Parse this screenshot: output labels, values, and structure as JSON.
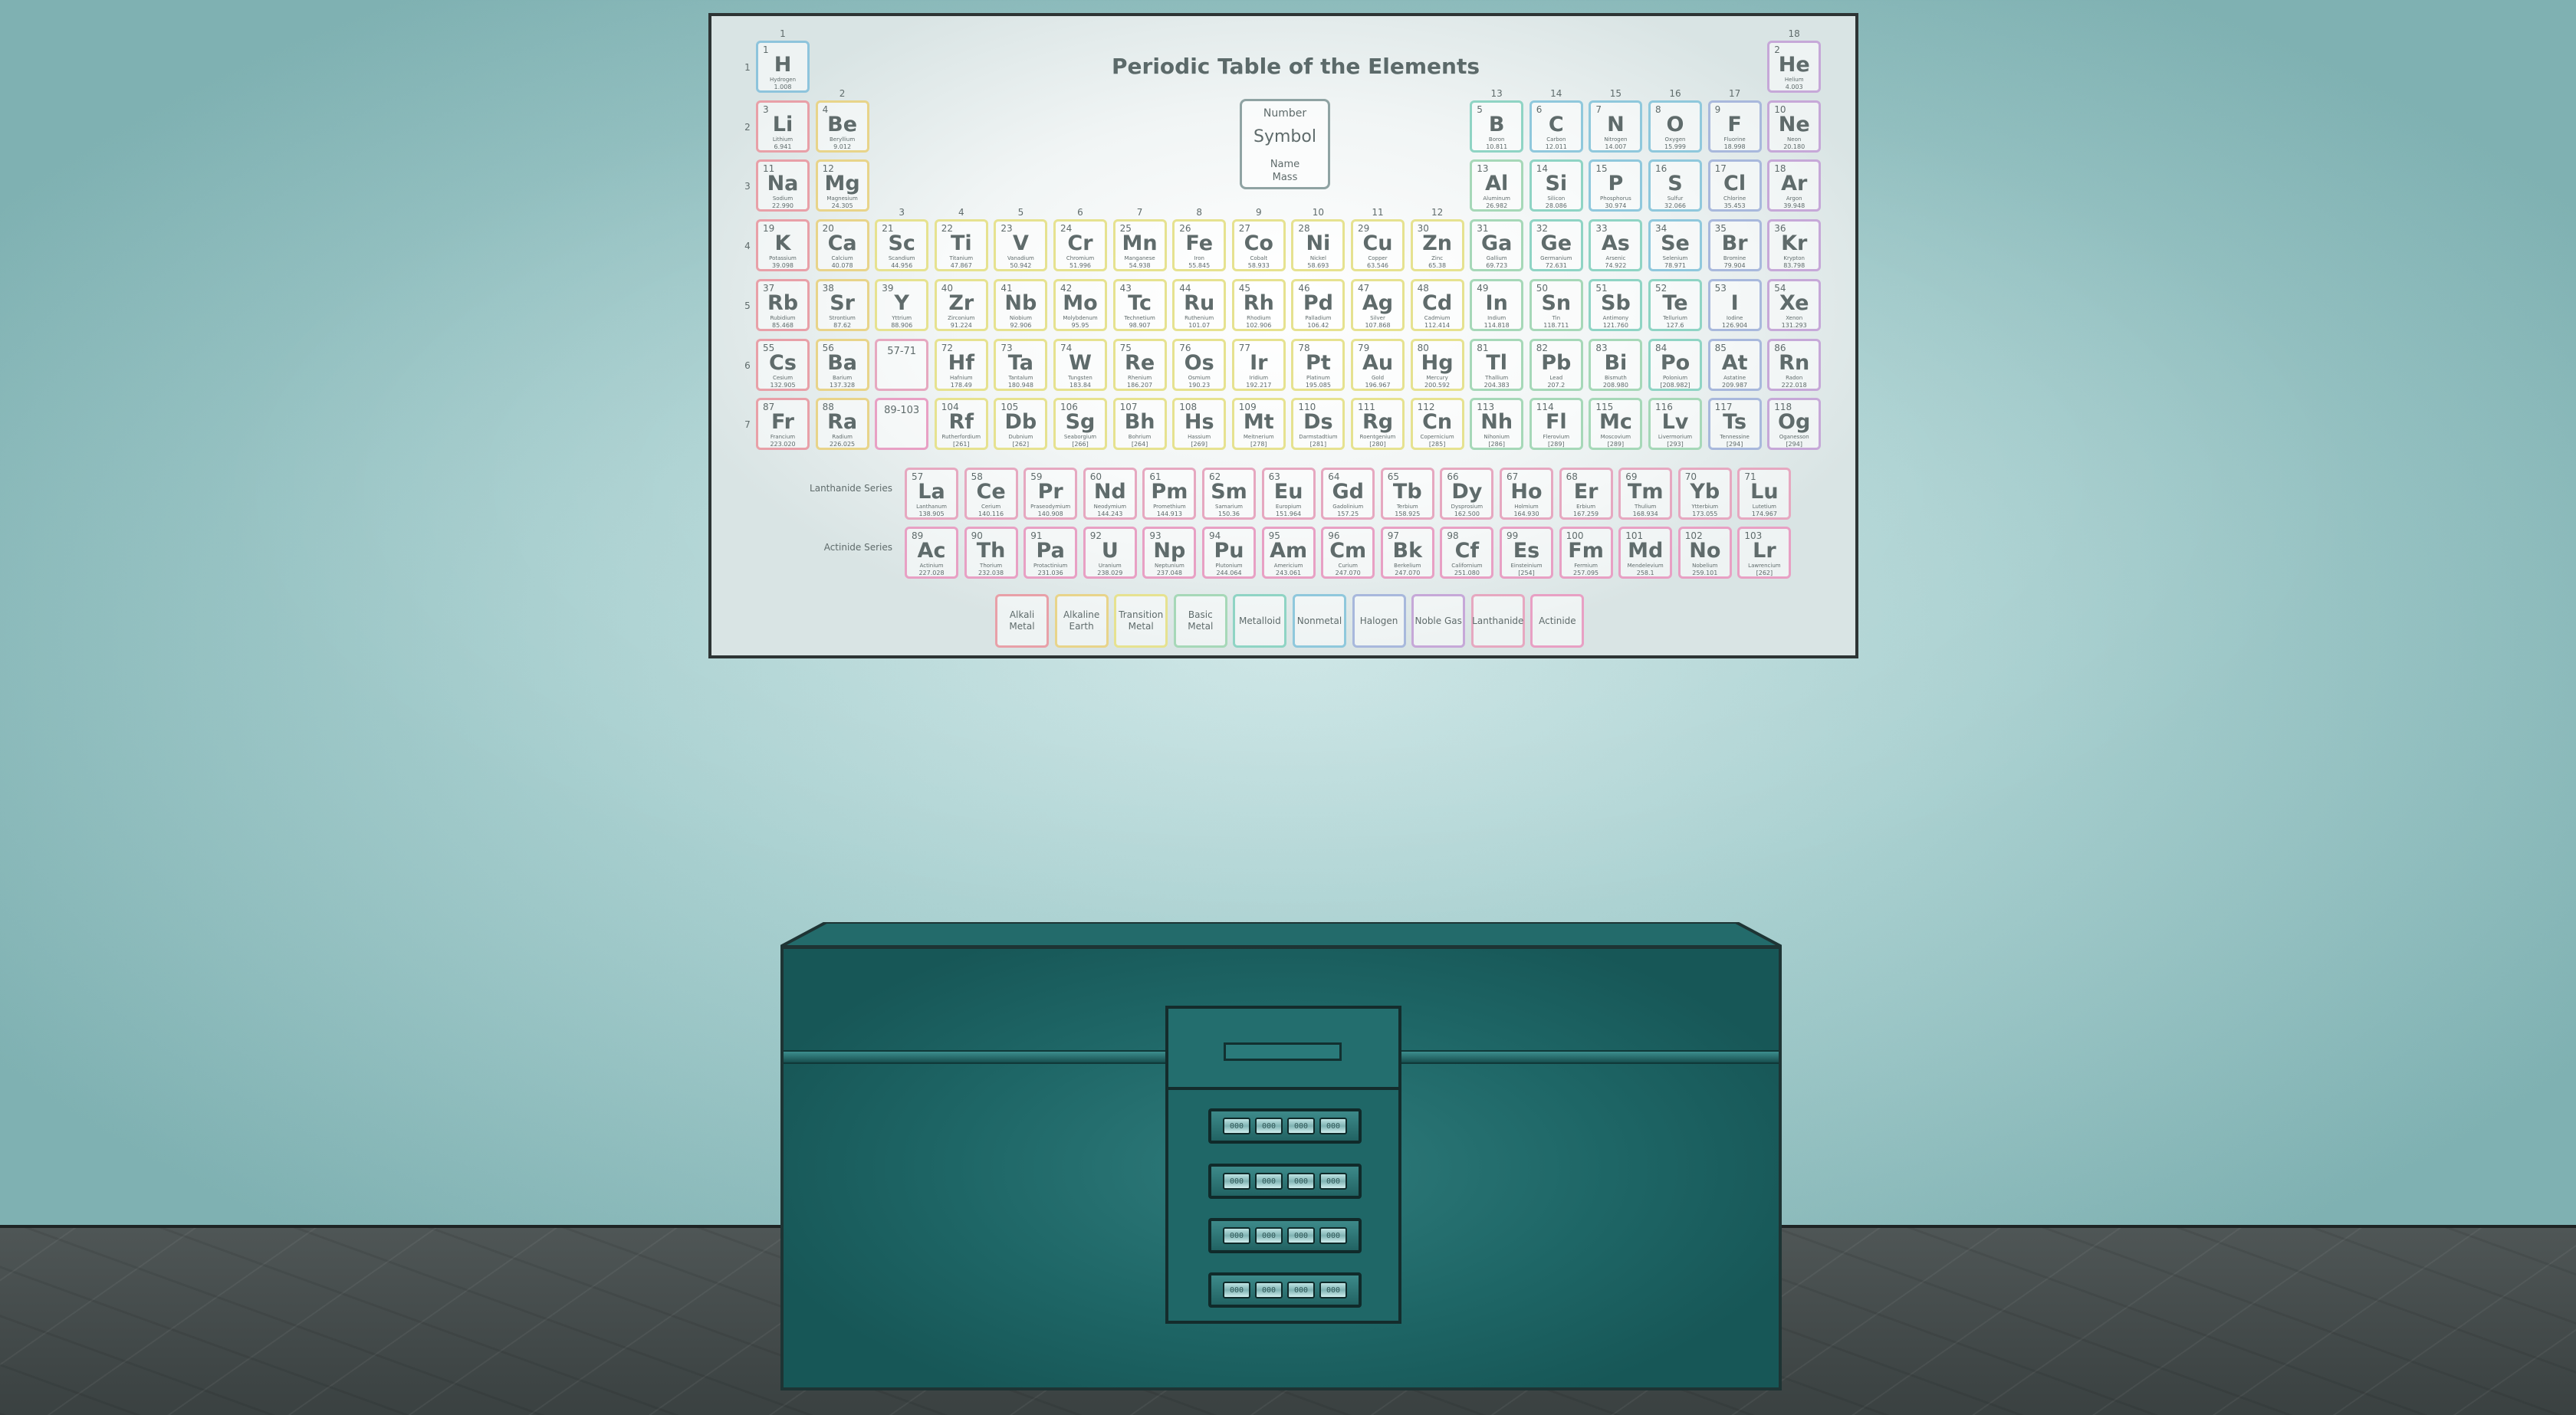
{
  "poster": {
    "title": "Periodic Table of the Elements",
    "key": {
      "number": "Number",
      "symbol": "Symbol",
      "name": "Name",
      "mass": "Mass"
    },
    "lanthanide_label": "Lanthanide Series",
    "actinide_label": "Actinide Series",
    "groups": [
      "1",
      "2",
      "3",
      "4",
      "5",
      "6",
      "7",
      "8",
      "9",
      "10",
      "11",
      "12",
      "13",
      "14",
      "15",
      "16",
      "17",
      "18"
    ],
    "periods": [
      "1",
      "2",
      "3",
      "4",
      "5",
      "6",
      "7"
    ],
    "category_colors": {
      "alkali": "#e8a0a8",
      "alkaline": "#e8d48a",
      "transition": "#e6e290",
      "basic": "#a6d8b8",
      "metalloid": "#8fd4c4",
      "nonmetal": "#8fc8dc",
      "halogen": "#a8b8dc",
      "noble": "#c6a8d8",
      "lanthanide": "#e6a8c0",
      "actinide": "#e8a0c4",
      "hydrogen": "#8ec4dc"
    },
    "legend": [
      {
        "label": "Alkali Metal",
        "cat": "alkali"
      },
      {
        "label": "Alkaline Earth",
        "cat": "alkaline"
      },
      {
        "label": "Transition Metal",
        "cat": "transition"
      },
      {
        "label": "Basic Metal",
        "cat": "basic"
      },
      {
        "label": "Metalloid",
        "cat": "metalloid"
      },
      {
        "label": "Nonmetal",
        "cat": "nonmetal"
      },
      {
        "label": "Halogen",
        "cat": "halogen"
      },
      {
        "label": "Noble Gas",
        "cat": "noble"
      },
      {
        "label": "Lanthanide",
        "cat": "lanthanide"
      },
      {
        "label": "Actinide",
        "cat": "actinide"
      }
    ],
    "elements": [
      {
        "n": 1,
        "s": "H",
        "name": "Hydrogen",
        "m": "1.008",
        "g": 1,
        "p": 1,
        "c": "hydrogen"
      },
      {
        "n": 2,
        "s": "He",
        "name": "Helium",
        "m": "4.003",
        "g": 18,
        "p": 1,
        "c": "noble"
      },
      {
        "n": 3,
        "s": "Li",
        "name": "Lithium",
        "m": "6.941",
        "g": 1,
        "p": 2,
        "c": "alkali"
      },
      {
        "n": 4,
        "s": "Be",
        "name": "Beryllium",
        "m": "9.012",
        "g": 2,
        "p": 2,
        "c": "alkaline"
      },
      {
        "n": 5,
        "s": "B",
        "name": "Boron",
        "m": "10.811",
        "g": 13,
        "p": 2,
        "c": "metalloid"
      },
      {
        "n": 6,
        "s": "C",
        "name": "Carbon",
        "m": "12.011",
        "g": 14,
        "p": 2,
        "c": "nonmetal"
      },
      {
        "n": 7,
        "s": "N",
        "name": "Nitrogen",
        "m": "14.007",
        "g": 15,
        "p": 2,
        "c": "nonmetal"
      },
      {
        "n": 8,
        "s": "O",
        "name": "Oxygen",
        "m": "15.999",
        "g": 16,
        "p": 2,
        "c": "nonmetal"
      },
      {
        "n": 9,
        "s": "F",
        "name": "Fluorine",
        "m": "18.998",
        "g": 17,
        "p": 2,
        "c": "halogen"
      },
      {
        "n": 10,
        "s": "Ne",
        "name": "Neon",
        "m": "20.180",
        "g": 18,
        "p": 2,
        "c": "noble"
      },
      {
        "n": 11,
        "s": "Na",
        "name": "Sodium",
        "m": "22.990",
        "g": 1,
        "p": 3,
        "c": "alkali"
      },
      {
        "n": 12,
        "s": "Mg",
        "name": "Magnesium",
        "m": "24.305",
        "g": 2,
        "p": 3,
        "c": "alkaline"
      },
      {
        "n": 13,
        "s": "Al",
        "name": "Aluminum",
        "m": "26.982",
        "g": 13,
        "p": 3,
        "c": "basic"
      },
      {
        "n": 14,
        "s": "Si",
        "name": "Silicon",
        "m": "28.086",
        "g": 14,
        "p": 3,
        "c": "metalloid"
      },
      {
        "n": 15,
        "s": "P",
        "name": "Phosphorus",
        "m": "30.974",
        "g": 15,
        "p": 3,
        "c": "nonmetal"
      },
      {
        "n": 16,
        "s": "S",
        "name": "Sulfur",
        "m": "32.066",
        "g": 16,
        "p": 3,
        "c": "nonmetal"
      },
      {
        "n": 17,
        "s": "Cl",
        "name": "Chlorine",
        "m": "35.453",
        "g": 17,
        "p": 3,
        "c": "halogen"
      },
      {
        "n": 18,
        "s": "Ar",
        "name": "Argon",
        "m": "39.948",
        "g": 18,
        "p": 3,
        "c": "noble"
      },
      {
        "n": 19,
        "s": "K",
        "name": "Potassium",
        "m": "39.098",
        "g": 1,
        "p": 4,
        "c": "alkali"
      },
      {
        "n": 20,
        "s": "Ca",
        "name": "Calcium",
        "m": "40.078",
        "g": 2,
        "p": 4,
        "c": "alkaline"
      },
      {
        "n": 21,
        "s": "Sc",
        "name": "Scandium",
        "m": "44.956",
        "g": 3,
        "p": 4,
        "c": "transition"
      },
      {
        "n": 22,
        "s": "Ti",
        "name": "Titanium",
        "m": "47.867",
        "g": 4,
        "p": 4,
        "c": "transition"
      },
      {
        "n": 23,
        "s": "V",
        "name": "Vanadium",
        "m": "50.942",
        "g": 5,
        "p": 4,
        "c": "transition"
      },
      {
        "n": 24,
        "s": "Cr",
        "name": "Chromium",
        "m": "51.996",
        "g": 6,
        "p": 4,
        "c": "transition"
      },
      {
        "n": 25,
        "s": "Mn",
        "name": "Manganese",
        "m": "54.938",
        "g": 7,
        "p": 4,
        "c": "transition"
      },
      {
        "n": 26,
        "s": "Fe",
        "name": "Iron",
        "m": "55.845",
        "g": 8,
        "p": 4,
        "c": "transition"
      },
      {
        "n": 27,
        "s": "Co",
        "name": "Cobalt",
        "m": "58.933",
        "g": 9,
        "p": 4,
        "c": "transition"
      },
      {
        "n": 28,
        "s": "Ni",
        "name": "Nickel",
        "m": "58.693",
        "g": 10,
        "p": 4,
        "c": "transition"
      },
      {
        "n": 29,
        "s": "Cu",
        "name": "Copper",
        "m": "63.546",
        "g": 11,
        "p": 4,
        "c": "transition"
      },
      {
        "n": 30,
        "s": "Zn",
        "name": "Zinc",
        "m": "65.38",
        "g": 12,
        "p": 4,
        "c": "transition"
      },
      {
        "n": 31,
        "s": "Ga",
        "name": "Gallium",
        "m": "69.723",
        "g": 13,
        "p": 4,
        "c": "basic"
      },
      {
        "n": 32,
        "s": "Ge",
        "name": "Germanium",
        "m": "72.631",
        "g": 14,
        "p": 4,
        "c": "metalloid"
      },
      {
        "n": 33,
        "s": "As",
        "name": "Arsenic",
        "m": "74.922",
        "g": 15,
        "p": 4,
        "c": "metalloid"
      },
      {
        "n": 34,
        "s": "Se",
        "name": "Selenium",
        "m": "78.971",
        "g": 16,
        "p": 4,
        "c": "nonmetal"
      },
      {
        "n": 35,
        "s": "Br",
        "name": "Bromine",
        "m": "79.904",
        "g": 17,
        "p": 4,
        "c": "halogen"
      },
      {
        "n": 36,
        "s": "Kr",
        "name": "Krypton",
        "m": "83.798",
        "g": 18,
        "p": 4,
        "c": "noble"
      },
      {
        "n": 37,
        "s": "Rb",
        "name": "Rubidium",
        "m": "85.468",
        "g": 1,
        "p": 5,
        "c": "alkali"
      },
      {
        "n": 38,
        "s": "Sr",
        "name": "Strontium",
        "m": "87.62",
        "g": 2,
        "p": 5,
        "c": "alkaline"
      },
      {
        "n": 39,
        "s": "Y",
        "name": "Yttrium",
        "m": "88.906",
        "g": 3,
        "p": 5,
        "c": "transition"
      },
      {
        "n": 40,
        "s": "Zr",
        "name": "Zirconium",
        "m": "91.224",
        "g": 4,
        "p": 5,
        "c": "transition"
      },
      {
        "n": 41,
        "s": "Nb",
        "name": "Niobium",
        "m": "92.906",
        "g": 5,
        "p": 5,
        "c": "transition"
      },
      {
        "n": 42,
        "s": "Mo",
        "name": "Molybdenum",
        "m": "95.95",
        "g": 6,
        "p": 5,
        "c": "transition"
      },
      {
        "n": 43,
        "s": "Tc",
        "name": "Technetium",
        "m": "98.907",
        "g": 7,
        "p": 5,
        "c": "transition"
      },
      {
        "n": 44,
        "s": "Ru",
        "name": "Ruthenium",
        "m": "101.07",
        "g": 8,
        "p": 5,
        "c": "transition"
      },
      {
        "n": 45,
        "s": "Rh",
        "name": "Rhodium",
        "m": "102.906",
        "g": 9,
        "p": 5,
        "c": "transition"
      },
      {
        "n": 46,
        "s": "Pd",
        "name": "Palladium",
        "m": "106.42",
        "g": 10,
        "p": 5,
        "c": "transition"
      },
      {
        "n": 47,
        "s": "Ag",
        "name": "Silver",
        "m": "107.868",
        "g": 11,
        "p": 5,
        "c": "transition"
      },
      {
        "n": 48,
        "s": "Cd",
        "name": "Cadmium",
        "m": "112.414",
        "g": 12,
        "p": 5,
        "c": "transition"
      },
      {
        "n": 49,
        "s": "In",
        "name": "Indium",
        "m": "114.818",
        "g": 13,
        "p": 5,
        "c": "basic"
      },
      {
        "n": 50,
        "s": "Sn",
        "name": "Tin",
        "m": "118.711",
        "g": 14,
        "p": 5,
        "c": "basic"
      },
      {
        "n": 51,
        "s": "Sb",
        "name": "Antimony",
        "m": "121.760",
        "g": 15,
        "p": 5,
        "c": "metalloid"
      },
      {
        "n": 52,
        "s": "Te",
        "name": "Tellurium",
        "m": "127.6",
        "g": 16,
        "p": 5,
        "c": "metalloid"
      },
      {
        "n": 53,
        "s": "I",
        "name": "Iodine",
        "m": "126.904",
        "g": 17,
        "p": 5,
        "c": "halogen"
      },
      {
        "n": 54,
        "s": "Xe",
        "name": "Xenon",
        "m": "131.293",
        "g": 18,
        "p": 5,
        "c": "noble"
      },
      {
        "n": 55,
        "s": "Cs",
        "name": "Cesium",
        "m": "132.905",
        "g": 1,
        "p": 6,
        "c": "alkali"
      },
      {
        "n": 56,
        "s": "Ba",
        "name": "Barium",
        "m": "137.328",
        "g": 2,
        "p": 6,
        "c": "alkaline"
      },
      {
        "n": 72,
        "s": "Hf",
        "name": "Hafnium",
        "m": "178.49",
        "g": 4,
        "p": 6,
        "c": "transition"
      },
      {
        "n": 73,
        "s": "Ta",
        "name": "Tantalum",
        "m": "180.948",
        "g": 5,
        "p": 6,
        "c": "transition"
      },
      {
        "n": 74,
        "s": "W",
        "name": "Tungsten",
        "m": "183.84",
        "g": 6,
        "p": 6,
        "c": "transition"
      },
      {
        "n": 75,
        "s": "Re",
        "name": "Rhenium",
        "m": "186.207",
        "g": 7,
        "p": 6,
        "c": "transition"
      },
      {
        "n": 76,
        "s": "Os",
        "name": "Osmium",
        "m": "190.23",
        "g": 8,
        "p": 6,
        "c": "transition"
      },
      {
        "n": 77,
        "s": "Ir",
        "name": "Iridium",
        "m": "192.217",
        "g": 9,
        "p": 6,
        "c": "transition"
      },
      {
        "n": 78,
        "s": "Pt",
        "name": "Platinum",
        "m": "195.085",
        "g": 10,
        "p": 6,
        "c": "transition"
      },
      {
        "n": 79,
        "s": "Au",
        "name": "Gold",
        "m": "196.967",
        "g": 11,
        "p": 6,
        "c": "transition"
      },
      {
        "n": 80,
        "s": "Hg",
        "name": "Mercury",
        "m": "200.592",
        "g": 12,
        "p": 6,
        "c": "transition"
      },
      {
        "n": 81,
        "s": "Tl",
        "name": "Thallium",
        "m": "204.383",
        "g": 13,
        "p": 6,
        "c": "basic"
      },
      {
        "n": 82,
        "s": "Pb",
        "name": "Lead",
        "m": "207.2",
        "g": 14,
        "p": 6,
        "c": "basic"
      },
      {
        "n": 83,
        "s": "Bi",
        "name": "Bismuth",
        "m": "208.980",
        "g": 15,
        "p": 6,
        "c": "basic"
      },
      {
        "n": 84,
        "s": "Po",
        "name": "Polonium",
        "m": "[208.982]",
        "g": 16,
        "p": 6,
        "c": "metalloid"
      },
      {
        "n": 85,
        "s": "At",
        "name": "Astatine",
        "m": "209.987",
        "g": 17,
        "p": 6,
        "c": "halogen"
      },
      {
        "n": 86,
        "s": "Rn",
        "name": "Radon",
        "m": "222.018",
        "g": 18,
        "p": 6,
        "c": "noble"
      },
      {
        "n": 87,
        "s": "Fr",
        "name": "Francium",
        "m": "223.020",
        "g": 1,
        "p": 7,
        "c": "alkali"
      },
      {
        "n": 88,
        "s": "Ra",
        "name": "Radium",
        "m": "226.025",
        "g": 2,
        "p": 7,
        "c": "alkaline"
      },
      {
        "n": 104,
        "s": "Rf",
        "name": "Rutherfordium",
        "m": "[261]",
        "g": 4,
        "p": 7,
        "c": "transition"
      },
      {
        "n": 105,
        "s": "Db",
        "name": "Dubnium",
        "m": "[262]",
        "g": 5,
        "p": 7,
        "c": "transition"
      },
      {
        "n": 106,
        "s": "Sg",
        "name": "Seaborgium",
        "m": "[266]",
        "g": 6,
        "p": 7,
        "c": "transition"
      },
      {
        "n": 107,
        "s": "Bh",
        "name": "Bohrium",
        "m": "[264]",
        "g": 7,
        "p": 7,
        "c": "transition"
      },
      {
        "n": 108,
        "s": "Hs",
        "name": "Hassium",
        "m": "[269]",
        "g": 8,
        "p": 7,
        "c": "transition"
      },
      {
        "n": 109,
        "s": "Mt",
        "name": "Meitnerium",
        "m": "[278]",
        "g": 9,
        "p": 7,
        "c": "transition"
      },
      {
        "n": 110,
        "s": "Ds",
        "name": "Darmstadtium",
        "m": "[281]",
        "g": 10,
        "p": 7,
        "c": "transition"
      },
      {
        "n": 111,
        "s": "Rg",
        "name": "Roentgenium",
        "m": "[280]",
        "g": 11,
        "p": 7,
        "c": "transition"
      },
      {
        "n": 112,
        "s": "Cn",
        "name": "Copernicium",
        "m": "[285]",
        "g": 12,
        "p": 7,
        "c": "transition"
      },
      {
        "n": 113,
        "s": "Nh",
        "name": "Nihonium",
        "m": "[286]",
        "g": 13,
        "p": 7,
        "c": "basic"
      },
      {
        "n": 114,
        "s": "Fl",
        "name": "Flerovium",
        "m": "[289]",
        "g": 14,
        "p": 7,
        "c": "basic"
      },
      {
        "n": 115,
        "s": "Mc",
        "name": "Moscovium",
        "m": "[289]",
        "g": 15,
        "p": 7,
        "c": "basic"
      },
      {
        "n": 116,
        "s": "Lv",
        "name": "Livermorium",
        "m": "[293]",
        "g": 16,
        "p": 7,
        "c": "basic"
      },
      {
        "n": 117,
        "s": "Ts",
        "name": "Tennessine",
        "m": "[294]",
        "g": 17,
        "p": 7,
        "c": "halogen"
      },
      {
        "n": 118,
        "s": "Og",
        "name": "Oganesson",
        "m": "[294]",
        "g": 18,
        "p": 7,
        "c": "noble"
      }
    ],
    "placeholders": [
      {
        "label": "57-71",
        "g": 3,
        "p": 6,
        "c": "lanthanide"
      },
      {
        "label": "89-103",
        "g": 3,
        "p": 7,
        "c": "actinide"
      }
    ],
    "lanthanides": [
      {
        "n": 57,
        "s": "La",
        "name": "Lanthanum",
        "m": "138.905"
      },
      {
        "n": 58,
        "s": "Ce",
        "name": "Cerium",
        "m": "140.116"
      },
      {
        "n": 59,
        "s": "Pr",
        "name": "Praseodymium",
        "m": "140.908"
      },
      {
        "n": 60,
        "s": "Nd",
        "name": "Neodymium",
        "m": "144.243"
      },
      {
        "n": 61,
        "s": "Pm",
        "name": "Promethium",
        "m": "144.913"
      },
      {
        "n": 62,
        "s": "Sm",
        "name": "Samarium",
        "m": "150.36"
      },
      {
        "n": 63,
        "s": "Eu",
        "name": "Europium",
        "m": "151.964"
      },
      {
        "n": 64,
        "s": "Gd",
        "name": "Gadolinium",
        "m": "157.25"
      },
      {
        "n": 65,
        "s": "Tb",
        "name": "Terbium",
        "m": "158.925"
      },
      {
        "n": 66,
        "s": "Dy",
        "name": "Dysprosium",
        "m": "162.500"
      },
      {
        "n": 67,
        "s": "Ho",
        "name": "Holmium",
        "m": "164.930"
      },
      {
        "n": 68,
        "s": "Er",
        "name": "Erbium",
        "m": "167.259"
      },
      {
        "n": 69,
        "s": "Tm",
        "name": "Thulium",
        "m": "168.934"
      },
      {
        "n": 70,
        "s": "Yb",
        "name": "Ytterbium",
        "m": "173.055"
      },
      {
        "n": 71,
        "s": "Lu",
        "name": "Lutetium",
        "m": "174.967"
      }
    ],
    "actinides": [
      {
        "n": 89,
        "s": "Ac",
        "name": "Actinium",
        "m": "227.028"
      },
      {
        "n": 90,
        "s": "Th",
        "name": "Thorium",
        "m": "232.038"
      },
      {
        "n": 91,
        "s": "Pa",
        "name": "Protactinium",
        "m": "231.036"
      },
      {
        "n": 92,
        "s": "U",
        "name": "Uranium",
        "m": "238.029"
      },
      {
        "n": 93,
        "s": "Np",
        "name": "Neptunium",
        "m": "237.048"
      },
      {
        "n": 94,
        "s": "Pu",
        "name": "Plutonium",
        "m": "244.064"
      },
      {
        "n": 95,
        "s": "Am",
        "name": "Americium",
        "m": "243.061"
      },
      {
        "n": 96,
        "s": "Cm",
        "name": "Curium",
        "m": "247.070"
      },
      {
        "n": 97,
        "s": "Bk",
        "name": "Berkelium",
        "m": "247.070"
      },
      {
        "n": 98,
        "s": "Cf",
        "name": "Californium",
        "m": "251.080"
      },
      {
        "n": 99,
        "s": "Es",
        "name": "Einsteinium",
        "m": "[254]"
      },
      {
        "n": 100,
        "s": "Fm",
        "name": "Fermium",
        "m": "257.095"
      },
      {
        "n": 101,
        "s": "Md",
        "name": "Mendelevium",
        "m": "258.1"
      },
      {
        "n": 102,
        "s": "No",
        "name": "Nobelium",
        "m": "259.101"
      },
      {
        "n": 103,
        "s": "Lr",
        "name": "Lawrencium",
        "m": "[262]"
      }
    ]
  },
  "chest": {
    "color": "#1f6868",
    "locks": [
      {
        "dials": [
          "000",
          "000",
          "000",
          "000"
        ]
      },
      {
        "dials": [
          "000",
          "000",
          "000",
          "000"
        ]
      },
      {
        "dials": [
          "000",
          "000",
          "000",
          "000"
        ]
      },
      {
        "dials": [
          "000",
          "000",
          "000",
          "000"
        ]
      }
    ]
  }
}
